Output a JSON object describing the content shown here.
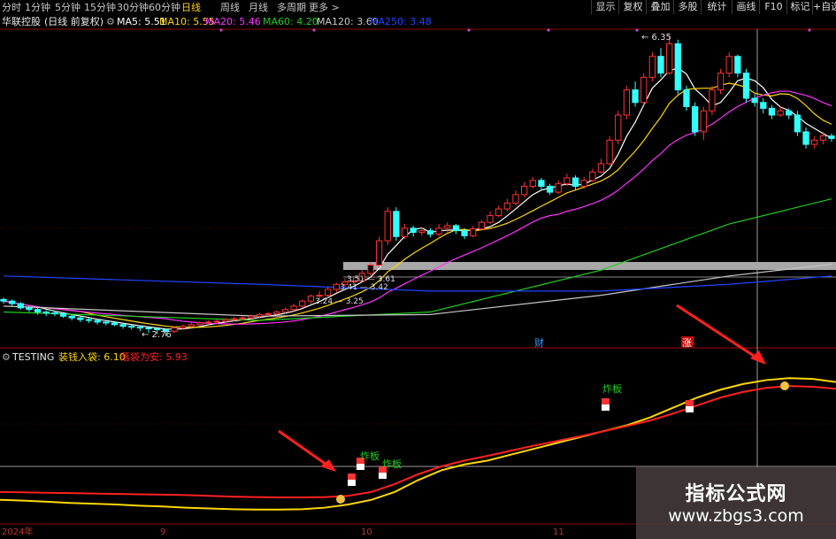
{
  "periods": [
    "分时",
    "1分钟",
    "5分钟",
    "15分钟",
    "30分钟",
    "60分钟",
    "日线",
    "周线",
    "月线",
    "多周期",
    "更多 >"
  ],
  "active_period": "日线",
  "toolbar": [
    "显示",
    "复权",
    "叠加",
    "多股",
    "统计",
    "画线",
    "F10",
    "标记",
    "+自选"
  ],
  "stock": {
    "name": "华联控股",
    "mode": "(日线 前复权)"
  },
  "ma": [
    {
      "label": "MA5: 5.51",
      "color": "#ffffff"
    },
    {
      "label": "MA10: 5.55",
      "color": "#ffd700"
    },
    {
      "label": "MA20: 5.46",
      "color": "#ff33ff"
    },
    {
      "label": "MA60: 4.20",
      "color": "#22cc22"
    },
    {
      "label": "MA120: 3.60",
      "color": "#c8c8c8"
    },
    {
      "label": "MA250: 3.48",
      "color": "#2244ff"
    }
  ],
  "price_labels": {
    "high": "6.35",
    "low": "2.76",
    "a1": "3.51",
    "a2": "3.61",
    "b1": "3.41",
    "b2": "3.42",
    "c1": "3.24",
    "c2": "3.25"
  },
  "markers": {
    "cai": "财",
    "zhang": "涨",
    "zha": "炸板"
  },
  "indicator": {
    "name": "TESTING",
    "label1": "装钱入袋: 6.10",
    "label1_color": "#ffd700",
    "label2": "落袋为安: 5.93",
    "label2_color": "#ff2020"
  },
  "date_axis": [
    "2024年",
    "9",
    "10",
    "11"
  ],
  "watermark": {
    "title": "指标公式网",
    "url": "www.zbgs3.com"
  },
  "colors": {
    "up": "#ff3333",
    "down": "#33ffff",
    "background": "#000000",
    "grid": "#8b0000"
  },
  "chart_data": {
    "type": "candlestick",
    "candles": [
      [
        3.2,
        3.18,
        3.22,
        3.15
      ],
      [
        3.18,
        3.15,
        3.2,
        3.12
      ],
      [
        3.15,
        3.1,
        3.17,
        3.08
      ],
      [
        3.1,
        3.08,
        3.12,
        3.05
      ],
      [
        3.08,
        3.05,
        3.1,
        3.02
      ],
      [
        3.05,
        3.04,
        3.07,
        3.0
      ],
      [
        3.04,
        3.03,
        3.06,
        3.0
      ],
      [
        3.03,
        3.0,
        3.05,
        2.98
      ],
      [
        3.0,
        2.98,
        3.02,
        2.95
      ],
      [
        2.98,
        2.96,
        3.0,
        2.93
      ],
      [
        2.96,
        2.95,
        2.98,
        2.92
      ],
      [
        2.95,
        2.93,
        2.97,
        2.9
      ],
      [
        2.93,
        2.92,
        2.95,
        2.89
      ],
      [
        2.92,
        2.9,
        2.93,
        2.88
      ],
      [
        2.9,
        2.88,
        2.92,
        2.85
      ],
      [
        2.88,
        2.87,
        2.9,
        2.84
      ],
      [
        2.87,
        2.86,
        2.89,
        2.82
      ],
      [
        2.86,
        2.85,
        2.88,
        2.8
      ],
      [
        2.85,
        2.84,
        2.86,
        2.79
      ],
      [
        2.84,
        2.82,
        2.85,
        2.76
      ],
      [
        2.82,
        2.86,
        2.88,
        2.8
      ],
      [
        2.86,
        2.88,
        2.9,
        2.84
      ],
      [
        2.88,
        2.9,
        2.92,
        2.86
      ],
      [
        2.9,
        2.92,
        2.94,
        2.88
      ],
      [
        2.92,
        2.93,
        2.95,
        2.9
      ],
      [
        2.93,
        2.94,
        2.96,
        2.91
      ],
      [
        2.94,
        2.96,
        2.98,
        2.92
      ],
      [
        2.96,
        2.97,
        2.99,
        2.94
      ],
      [
        2.97,
        2.98,
        3.0,
        2.95
      ],
      [
        2.98,
        3.0,
        3.02,
        2.96
      ],
      [
        3.0,
        3.02,
        3.04,
        2.98
      ],
      [
        3.02,
        3.03,
        3.05,
        3.0
      ],
      [
        3.03,
        3.05,
        3.07,
        3.01
      ],
      [
        3.05,
        3.08,
        3.1,
        3.03
      ],
      [
        3.08,
        3.12,
        3.15,
        3.06
      ],
      [
        3.12,
        3.18,
        3.2,
        3.1
      ],
      [
        3.18,
        3.24,
        3.26,
        3.15
      ],
      [
        3.24,
        3.25,
        3.3,
        3.2
      ],
      [
        3.25,
        3.32,
        3.35,
        3.22
      ],
      [
        3.32,
        3.38,
        3.4,
        3.28
      ],
      [
        3.38,
        3.41,
        3.45,
        3.35
      ],
      [
        3.41,
        3.42,
        3.48,
        3.38
      ],
      [
        3.42,
        3.51,
        3.55,
        3.4
      ],
      [
        3.51,
        3.61,
        3.65,
        3.48
      ],
      [
        3.61,
        3.9,
        3.95,
        3.58
      ],
      [
        3.9,
        4.25,
        4.3,
        3.85
      ],
      [
        4.25,
        3.95,
        4.3,
        3.9
      ],
      [
        3.95,
        4.05,
        4.1,
        3.92
      ],
      [
        4.05,
        4.0,
        4.08,
        3.95
      ],
      [
        4.0,
        4.02,
        4.06,
        3.96
      ],
      [
        4.02,
        3.98,
        4.05,
        3.94
      ],
      [
        3.98,
        4.05,
        4.1,
        3.95
      ],
      [
        4.05,
        4.08,
        4.12,
        4.0
      ],
      [
        4.08,
        4.02,
        4.1,
        3.98
      ],
      [
        4.02,
        3.96,
        4.05,
        3.92
      ],
      [
        3.96,
        4.04,
        4.08,
        3.94
      ],
      [
        4.04,
        4.12,
        4.15,
        4.02
      ],
      [
        4.12,
        4.2,
        4.25,
        4.1
      ],
      [
        4.2,
        4.28,
        4.32,
        4.18
      ],
      [
        4.28,
        4.35,
        4.4,
        4.25
      ],
      [
        4.35,
        4.45,
        4.5,
        4.32
      ],
      [
        4.45,
        4.55,
        4.6,
        4.42
      ],
      [
        4.55,
        4.62,
        4.66,
        4.52
      ],
      [
        4.62,
        4.55,
        4.65,
        4.5
      ],
      [
        4.55,
        4.48,
        4.58,
        4.45
      ],
      [
        4.48,
        4.58,
        4.62,
        4.46
      ],
      [
        4.58,
        4.65,
        4.7,
        4.55
      ],
      [
        4.65,
        4.55,
        4.68,
        4.5
      ],
      [
        4.55,
        4.62,
        4.66,
        4.52
      ],
      [
        4.62,
        4.72,
        4.76,
        4.6
      ],
      [
        4.72,
        4.82,
        4.88,
        4.7
      ],
      [
        4.82,
        5.1,
        5.15,
        4.8
      ],
      [
        5.1,
        5.4,
        5.45,
        5.05
      ],
      [
        5.4,
        5.7,
        5.75,
        5.35
      ],
      [
        5.7,
        5.55,
        5.8,
        5.5
      ],
      [
        5.55,
        5.85,
        5.9,
        5.52
      ],
      [
        5.85,
        6.1,
        6.15,
        5.8
      ],
      [
        6.1,
        5.9,
        6.2,
        5.85
      ],
      [
        5.9,
        6.25,
        6.35,
        5.88
      ],
      [
        6.25,
        5.7,
        6.3,
        5.65
      ],
      [
        5.7,
        5.5,
        5.75,
        5.45
      ],
      [
        5.5,
        5.2,
        5.55,
        5.15
      ],
      [
        5.2,
        5.45,
        5.5,
        5.1
      ],
      [
        5.45,
        5.7,
        5.75,
        5.4
      ],
      [
        5.7,
        5.9,
        5.95,
        5.65
      ],
      [
        5.9,
        6.1,
        6.15,
        5.85
      ],
      [
        6.1,
        5.9,
        6.12,
        5.85
      ],
      [
        5.9,
        5.6,
        5.95,
        5.55
      ],
      [
        5.6,
        5.55,
        5.65,
        5.5
      ],
      [
        5.55,
        5.48,
        5.6,
        5.42
      ],
      [
        5.48,
        5.4,
        5.52,
        5.35
      ],
      [
        5.4,
        5.45,
        5.5,
        5.38
      ],
      [
        5.45,
        5.4,
        5.48,
        5.35
      ],
      [
        5.4,
        5.2,
        5.45,
        5.15
      ],
      [
        5.2,
        5.05,
        5.25,
        5.0
      ],
      [
        5.05,
        5.1,
        5.15,
        5.0
      ],
      [
        5.1,
        5.15,
        5.2,
        5.05
      ],
      [
        5.15,
        5.12,
        5.18,
        5.08
      ]
    ],
    "indicator_series": [
      {
        "name": "装钱入袋",
        "color": "#ffd700",
        "values": [
          3.1,
          3.08,
          3.05,
          3.02,
          3.0,
          2.98,
          2.95,
          2.93,
          2.9,
          2.88,
          2.86,
          2.85,
          2.85,
          2.86,
          2.9,
          2.98,
          3.1,
          3.3,
          3.6,
          3.85,
          4.0,
          4.1,
          4.25,
          4.4,
          4.55,
          4.7,
          4.85,
          5.0,
          5.2,
          5.45,
          5.7,
          5.9,
          6.05,
          6.15,
          6.2,
          6.18,
          6.1
        ]
      },
      {
        "name": "落袋为安",
        "color": "#ff2020",
        "values": [
          3.3,
          3.29,
          3.28,
          3.27,
          3.26,
          3.25,
          3.24,
          3.23,
          3.22,
          3.2,
          3.18,
          3.17,
          3.16,
          3.16,
          3.17,
          3.2,
          3.3,
          3.5,
          3.75,
          3.95,
          4.1,
          4.22,
          4.35,
          4.48,
          4.6,
          4.72,
          4.85,
          4.98,
          5.12,
          5.3,
          5.5,
          5.7,
          5.85,
          5.95,
          6.0,
          5.98,
          5.93
        ]
      }
    ]
  }
}
